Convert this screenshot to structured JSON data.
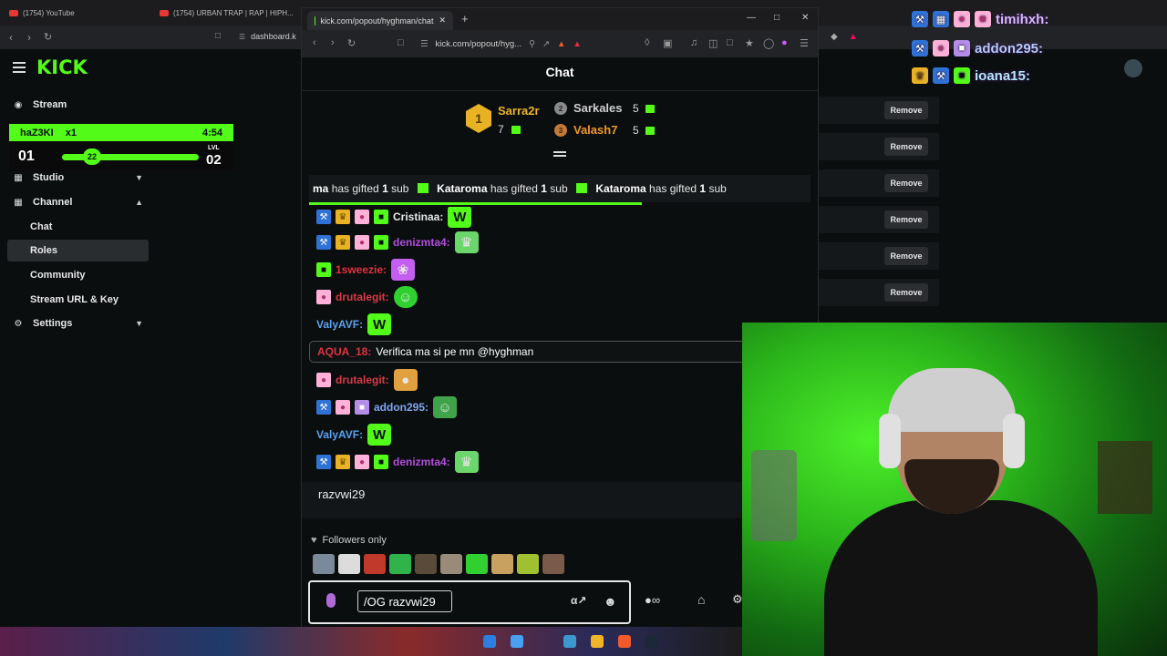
{
  "background_browser": {
    "tabs": [
      {
        "label": "(1754) YouTube"
      },
      {
        "label": "(1754) URBAN TRAP | RAP | HIPH..."
      }
    ],
    "url": "dashboard.k"
  },
  "dashboard": {
    "logo": "KICK",
    "nav": {
      "stream": "Stream",
      "studio": "Studio",
      "channel": "Channel",
      "chat": "Chat",
      "roles": "Roles",
      "community": "Community",
      "stream_url": "Stream URL & Key",
      "settings": "Settings"
    },
    "roles_remove_label": "Remove"
  },
  "level_widget": {
    "name": "haZ3KI",
    "multiplier": "x1",
    "timer": "4:54",
    "current_level": "01",
    "progress_value": "22",
    "progress_fraction": 0.22,
    "next_label": "LVL",
    "next_level": "02"
  },
  "overlay_chat": {
    "users": [
      {
        "name": "timihxh:"
      },
      {
        "name": "addon295:"
      },
      {
        "name": "ioana15:"
      }
    ]
  },
  "popout": {
    "tab_title": "kick.com/popout/hyghman/chat",
    "url": "kick.com/popout/hyg...",
    "chat_title": "Chat",
    "leaderboard": {
      "first": {
        "rank": "1",
        "name": "Sarra2r",
        "count": "7"
      },
      "second": {
        "rank": "2",
        "name": "Sarkales",
        "count": "5"
      },
      "third": {
        "rank": "3",
        "name": "Valash7",
        "count": "5"
      }
    },
    "ticker": {
      "partial_name": "ma",
      "gifter": "Kataroma",
      "phrase": "has gifted",
      "amount": "1",
      "unit": "sub"
    },
    "messages": [
      {
        "user": "Cristinaa:",
        "color": "#e6e6e6"
      },
      {
        "user": "denizmta4:",
        "color": "#b04fdc"
      },
      {
        "user": "1sweezie:",
        "color": "#e0313f"
      },
      {
        "user": "drutalegit:",
        "color": "#d93a47"
      },
      {
        "user": "ValyAVF:",
        "color": "#5aa2f0"
      },
      {
        "user": "AQUA_18:",
        "color": "#e0313f",
        "text": "Verifica ma si pe mn @hyghman"
      },
      {
        "user": "drutalegit:",
        "color": "#d93a47"
      },
      {
        "user": "addon295:",
        "color": "#7da6f2"
      },
      {
        "user": "ValyAVF:",
        "color": "#5aa2f0"
      },
      {
        "user": "denizmta4:",
        "color": "#b04fdc"
      }
    ],
    "chatter_name": "razvwi29",
    "followers_label": "Followers only",
    "input_value": "/OG razvwi29"
  },
  "colors": {
    "accent": "#53fc18",
    "bg": "#0b0e0f"
  }
}
